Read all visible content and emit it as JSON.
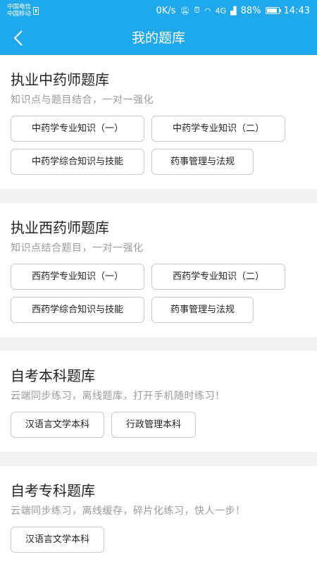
{
  "statusbar": {
    "carrier1": "中国电信",
    "carrier2": "中国移动",
    "net_speed": "0K/s",
    "signal": "4G",
    "battery": "88%",
    "time": "14:43"
  },
  "appbar": {
    "title": "我的题库"
  },
  "sections": [
    {
      "title": "执业中药师题库",
      "subtitle": "知识点与题目结合，一对一强化",
      "buttons": [
        "中药学专业知识（一）",
        "中药学专业知识（二）",
        "中药学综合知识与技能",
        "药事管理与法规"
      ]
    },
    {
      "title": "执业西药师题库",
      "subtitle": "知识点结合题目，一对一强化",
      "buttons": [
        "西药学专业知识（一）",
        "西药学专业知识（二）",
        "西药学综合知识与技能",
        "药事管理与法规"
      ]
    },
    {
      "title": "自考本科题库",
      "subtitle": "云端同步练习，离线题库，打开手机随时练习！",
      "buttons": [
        "汉语言文学本科",
        "行政管理本科"
      ]
    },
    {
      "title": "自考专科题库",
      "subtitle": "云端同步练习，离线缓存，碎片化练习，快人一步！",
      "buttons": [
        "汉语言文学本科"
      ]
    }
  ]
}
